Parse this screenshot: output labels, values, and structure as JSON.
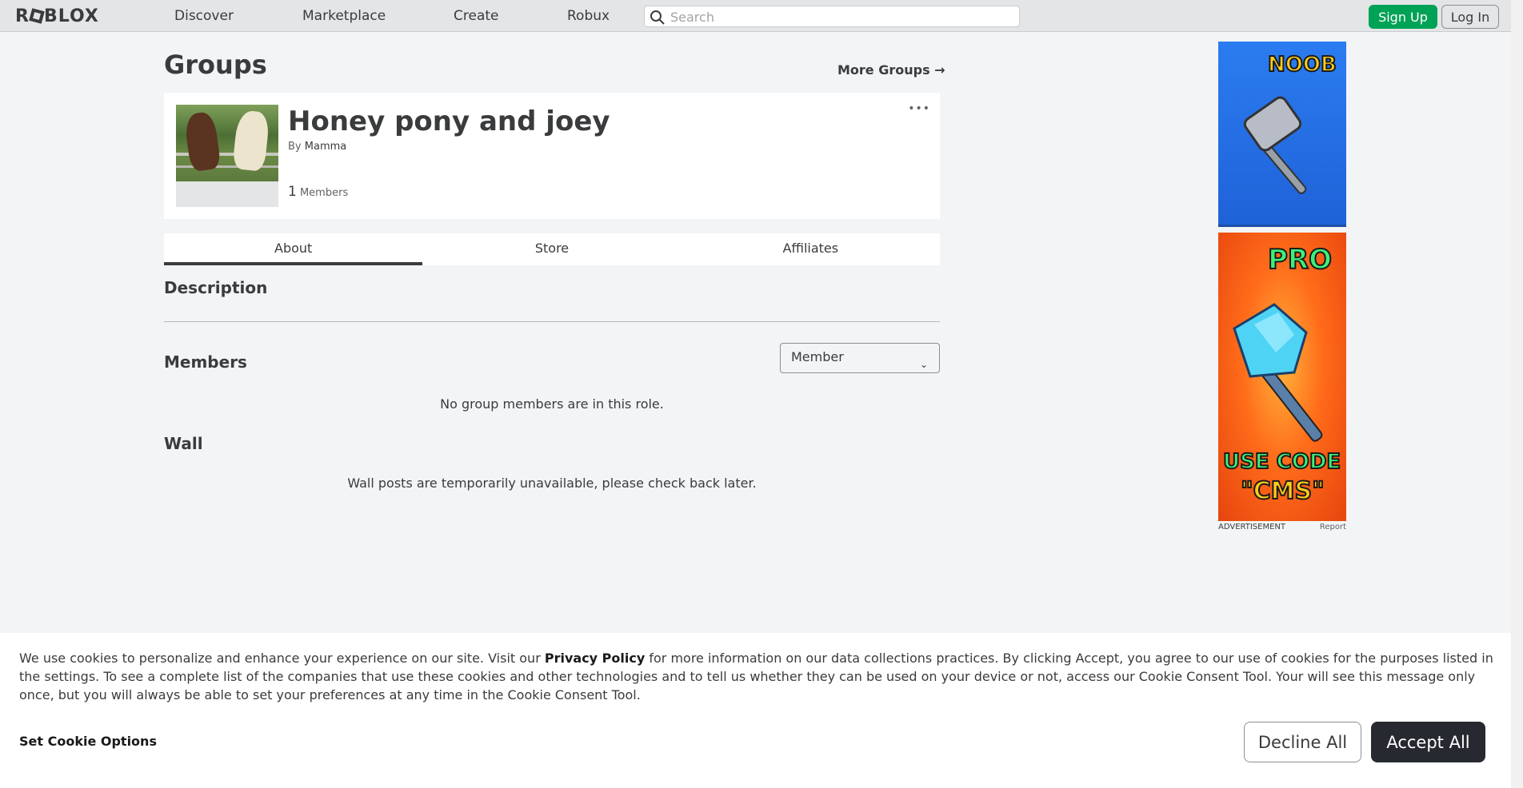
{
  "header": {
    "logo": "ROBLOX",
    "nav": [
      "Discover",
      "Marketplace",
      "Create",
      "Robux"
    ],
    "search_placeholder": "Search",
    "signup_label": "Sign Up",
    "login_label": "Log In"
  },
  "page": {
    "title": "Groups",
    "more_groups": "More Groups →"
  },
  "group": {
    "name": "Honey pony and joey",
    "by_prefix": "By",
    "owner": "Mamma",
    "member_count": "1",
    "members_label": "Members",
    "menu_glyph": "•••"
  },
  "tabs": [
    "About",
    "Store",
    "Affiliates"
  ],
  "about": {
    "description_title": "Description",
    "members_title": "Members",
    "role_selected": "Member",
    "no_members": "No group members are in this role.",
    "wall_title": "Wall",
    "wall_note": "Wall posts are temporarily unavailable, please check back later."
  },
  "ads": {
    "ad1_text": "NOOB",
    "ad2_top": "PRO",
    "ad2_line1": "USE CODE",
    "ad2_line2": "\"CMS\"",
    "label": "ADVERTISEMENT",
    "report": "Report"
  },
  "cookie": {
    "text_before": "We use cookies to personalize and enhance your experience on our site. Visit our ",
    "link": "Privacy Policy",
    "text_after": " for more information on our data collections practices. By clicking Accept, you agree to our use of cookies for the purposes listed in the settings. To see a complete list of the companies that use these cookies and other technologies and to tell us whether they can be used on your device or not, access our Cookie Consent Tool. Your will see this message only once, but you will always be able to set your preferences at any time in the Cookie Consent Tool.",
    "set_options": "Set Cookie Options",
    "decline": "Decline All",
    "accept": "Accept All"
  },
  "colors": {
    "signup_green": "#00a255",
    "accept_dark": "#272930",
    "background": "#f2f4f5"
  }
}
